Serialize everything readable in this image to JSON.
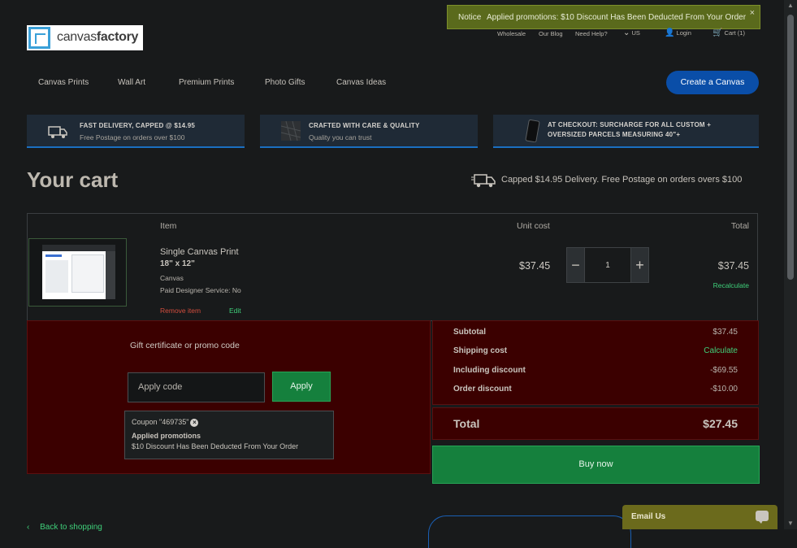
{
  "brand": {
    "name_light": "canvas",
    "name_bold": "factory"
  },
  "notice": {
    "label": "Notice",
    "message": "Applied promotions: $10 Discount Has Been Deducted From Your Order",
    "close": "×"
  },
  "top_links": {
    "wholesale": "Wholesale",
    "blog": "Our Blog",
    "help": "Need Help?",
    "region": "US",
    "login": "Login",
    "cart": "Cart (1)"
  },
  "nav": {
    "items": [
      "Canvas Prints",
      "Wall Art",
      "Premium Prints",
      "Photo Gifts",
      "Canvas Ideas"
    ],
    "cta": "Create a Canvas"
  },
  "features": [
    {
      "title": "FAST DELIVERY, CAPPED @ $14.95",
      "subtitle": "Free Postage on orders over $100",
      "icon": "delivery-truck-icon"
    },
    {
      "title": "CRAFTED WITH CARE & QUALITY",
      "subtitle": "Quality you can trust",
      "icon": "canvas-texture-icon"
    },
    {
      "title": "AT CHECKOUT: SURCHARGE FOR ALL CUSTOM +",
      "title2": "OVERSIZED PARCELS MEASURING 40\"+",
      "subtitle": "",
      "icon": "phone-icon"
    }
  ],
  "cart": {
    "title": "Your cart",
    "delivery_note": "Capped $14.95 Delivery. Free Postage on orders overs $100",
    "headers": {
      "item": "Item",
      "unit_cost": "Unit cost",
      "total": "Total"
    },
    "item": {
      "name": "Single Canvas Print",
      "size": "18\" x 12\"",
      "material": "Canvas",
      "designer_label": "Paid Designer Service:",
      "designer_value": "No",
      "remove": "Remove item",
      "edit": "Edit",
      "unit_cost": "$37.45",
      "quantity": "1",
      "total": "$37.45",
      "recalculate": "Recalculate"
    }
  },
  "promo": {
    "label": "Gift certificate or promo code",
    "placeholder": "Apply code",
    "apply": "Apply",
    "coupon": "Coupon \"469735\"",
    "applied_title": "Applied promotions",
    "applied_text": "$10 Discount Has Been Deducted From Your Order"
  },
  "summary": {
    "subtotal_label": "Subtotal",
    "subtotal": "$37.45",
    "shipping_label": "Shipping cost",
    "shipping": "Calculate",
    "including_label": "Including discount",
    "including": "-$69.55",
    "order_label": "Order discount",
    "order": "-$10.00",
    "total_label": "Total",
    "total": "$27.45",
    "buy": "Buy now"
  },
  "footer": {
    "back": "Back to shopping",
    "email_us": "Email Us"
  },
  "colors": {
    "accent_blue": "#0a4ea8",
    "green": "#15803d",
    "promo_bg": "#3b0000",
    "link_green": "#3fd07a"
  }
}
